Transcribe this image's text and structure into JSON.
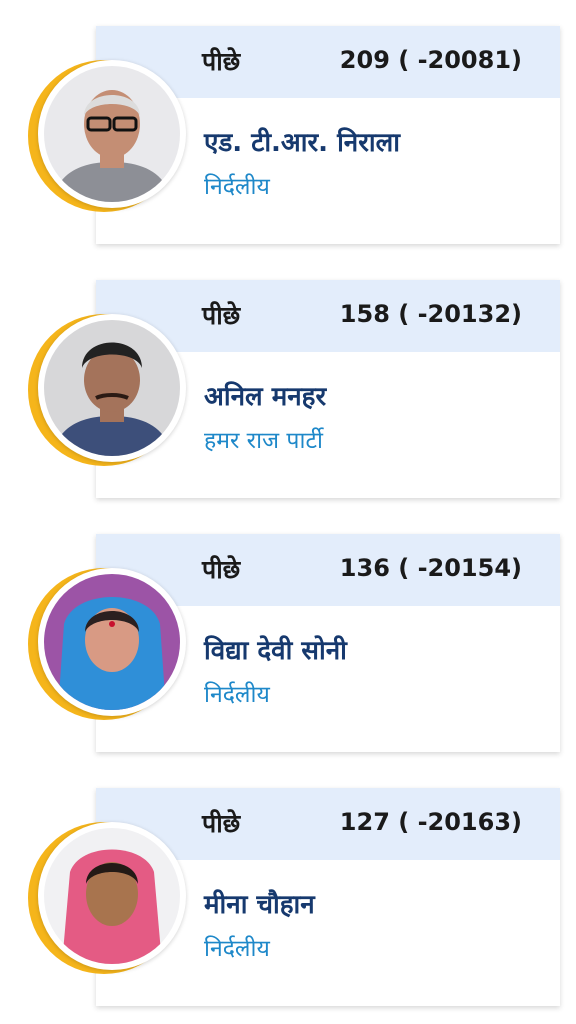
{
  "candidates": [
    {
      "status": "पीछे",
      "votes": "209 ( -20081)",
      "name": "एड. टी.आर. निराला",
      "party": "निर्दलीय",
      "photo_bg": "#e9e9ec",
      "skin": "#c48e74",
      "hair": "#dcdcdc",
      "cloth": "#8d8f96"
    },
    {
      "status": "पीछे",
      "votes": "158 ( -20132)",
      "name": "अनिल मनहर",
      "party": "हमर राज पार्टी",
      "photo_bg": "#d7d7d9",
      "skin": "#a4735b",
      "hair": "#222222",
      "cloth": "#3d4f7a"
    },
    {
      "status": "पीछे",
      "votes": "136 ( -20154)",
      "name": "विद्या देवी सोनी",
      "party": "निर्दलीय",
      "photo_bg": "#9c54a6",
      "skin": "#d89a84",
      "hair": "#2b2020",
      "cloth": "#2f8fd8"
    },
    {
      "status": "पीछे",
      "votes": "127 ( -20163)",
      "name": "मीना चौहान",
      "party": "निर्दलीय",
      "photo_bg": "#f1f1f3",
      "skin": "#a8744e",
      "hair": "#231a16",
      "cloth": "#e45b84"
    }
  ],
  "colors": {
    "accent_ring": "#f5b51b",
    "header_bg": "#e3edfb",
    "name_color": "#16396e",
    "party_color": "#1e88c9"
  }
}
